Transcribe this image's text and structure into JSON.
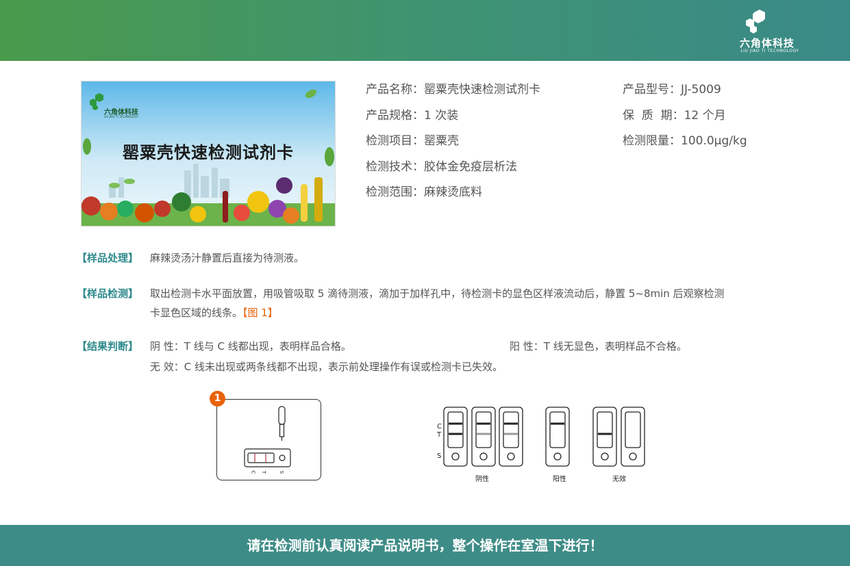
{
  "brand": {
    "name_cn": "六角体科技",
    "name_en": "LIU JIAO TI TECHNOLOGY"
  },
  "product_image": {
    "brand_cn": "六角体科技",
    "brand_en": "LIU JIAO TI TECHNOLOGY",
    "title": "罂粟壳快速检测试剂卡"
  },
  "info": {
    "name": "产品名称：罂粟壳快速检测试剂卡",
    "spec": "产品规格：1 次装",
    "item": "检测项目：罂粟壳",
    "tech": "检测技术：胶体金免疫层析法",
    "scope": "检测范围：麻辣烫底料",
    "model": "产品型号：JJ-5009",
    "shelf": "保  质  期：12 个月",
    "limit": "检测限量：100.0μg/kg"
  },
  "sections": {
    "prep_label": "【样品处理】",
    "prep_text": "麻辣烫汤汁静置后直接为待测液。",
    "test_label": "【样品检测】",
    "test_text1": "取出检测卡水平面放置，用吸管吸取 5 滴待测液，滴加于加样孔中，待检测卡的显色区样液流动后，静置 5~8min 后观察检测",
    "test_text2": "卡显色区域的线条。",
    "test_ref": "【图 1】",
    "result_label": "【结果判断】",
    "negative": "阴 性：T 线与 C 线都出现，表明样品合格。",
    "positive": "阳 性：T 线无显色，表明样品不合格。",
    "invalid": "无 效：C 线未出现或两条线都不出现，表示前处理操作有误或检测卡已失效。"
  },
  "figure1": {
    "number": "1",
    "labels": [
      "C",
      "T",
      "S"
    ]
  },
  "figure2": {
    "side_labels": [
      "C",
      "T",
      "S"
    ],
    "captions": [
      "阴性",
      "阳性",
      "无效"
    ]
  },
  "footer": {
    "text": "请在检测前认真阅读产品说明书，整个操作在室温下进行！"
  },
  "colors": {
    "header_green": "#4a9a4c",
    "header_teal": "#3a8a88",
    "label_teal": "#2f8a8c",
    "accent_orange": "#e8630a",
    "footer_teal": "#3e8c87",
    "line_red": "#b0303a"
  }
}
